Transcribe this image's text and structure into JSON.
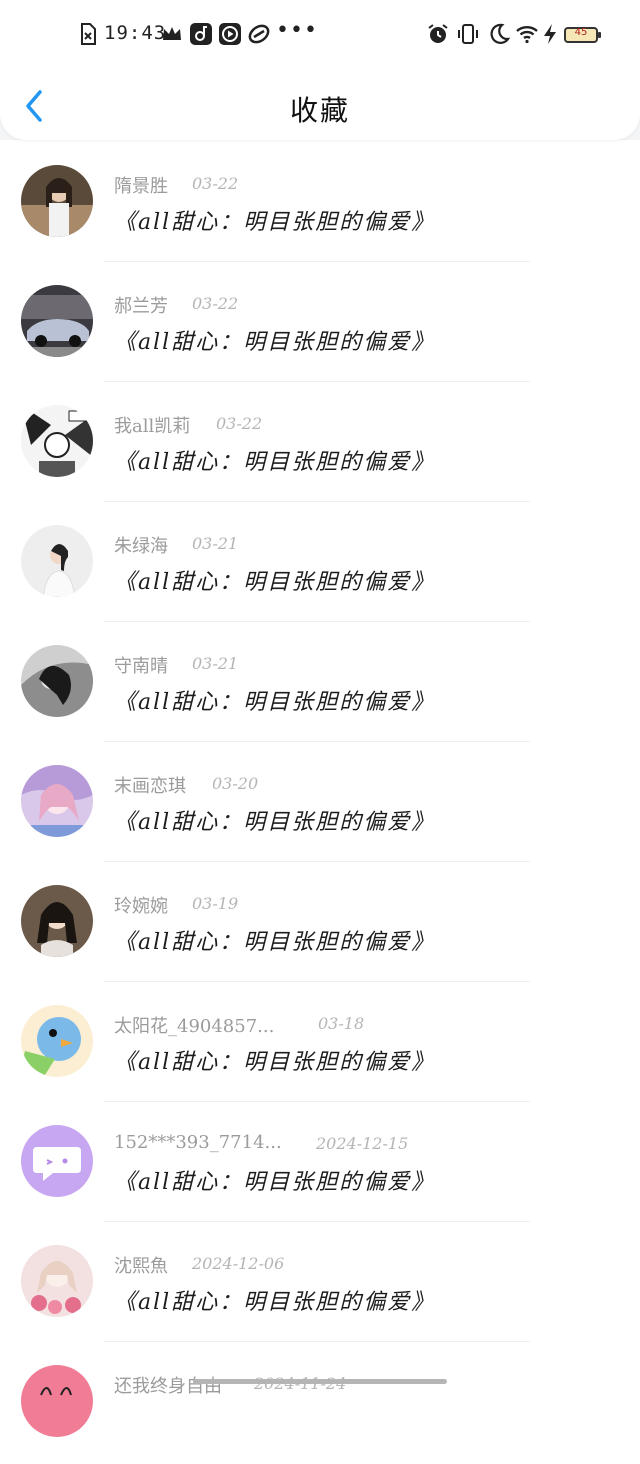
{
  "status_bar": {
    "time": "19:43",
    "battery": "45",
    "left_icons": [
      "file-x-icon",
      "crown-icon",
      "music-app-icon",
      "play-app-icon",
      "link-app-icon"
    ],
    "right_icons": [
      "alarm-icon",
      "vibrate-icon",
      "moon-icon",
      "wifi-icon",
      "charging-icon",
      "battery-icon"
    ]
  },
  "header": {
    "title": "收藏",
    "back_icon": "chevron-left-icon"
  },
  "accent_color": "#2196f3",
  "items": [
    {
      "name": "隋景胜",
      "date": "03-22",
      "title": "《all甜心：明目张胆的偏爱》"
    },
    {
      "name": "郝兰芳",
      "date": "03-22",
      "title": "《all甜心：明目张胆的偏爱》"
    },
    {
      "name": "我all凯莉",
      "date": "03-22",
      "title": "《all甜心：明目张胆的偏爱》"
    },
    {
      "name": "朱绿海",
      "date": "03-21",
      "title": "《all甜心：明目张胆的偏爱》"
    },
    {
      "name": "守南晴",
      "date": "03-21",
      "title": "《all甜心：明目张胆的偏爱》"
    },
    {
      "name": "末画恋琪",
      "date": "03-20",
      "title": "《all甜心：明目张胆的偏爱》"
    },
    {
      "name": "玲婉婉",
      "date": "03-19",
      "title": "《all甜心：明目张胆的偏爱》"
    },
    {
      "name": "太阳花_4904857...",
      "date": "03-18",
      "title": "《all甜心：明目张胆的偏爱》"
    },
    {
      "name": "152***393_7714...",
      "date": "2024-12-15",
      "title": "《all甜心：明目张胆的偏爱》"
    },
    {
      "name": "沈熙魚",
      "date": "2024-12-06",
      "title": "《all甜心：明目张胆的偏爱》"
    },
    {
      "name": "还我终身自由",
      "date": "2024-11-24",
      "title": ""
    }
  ]
}
